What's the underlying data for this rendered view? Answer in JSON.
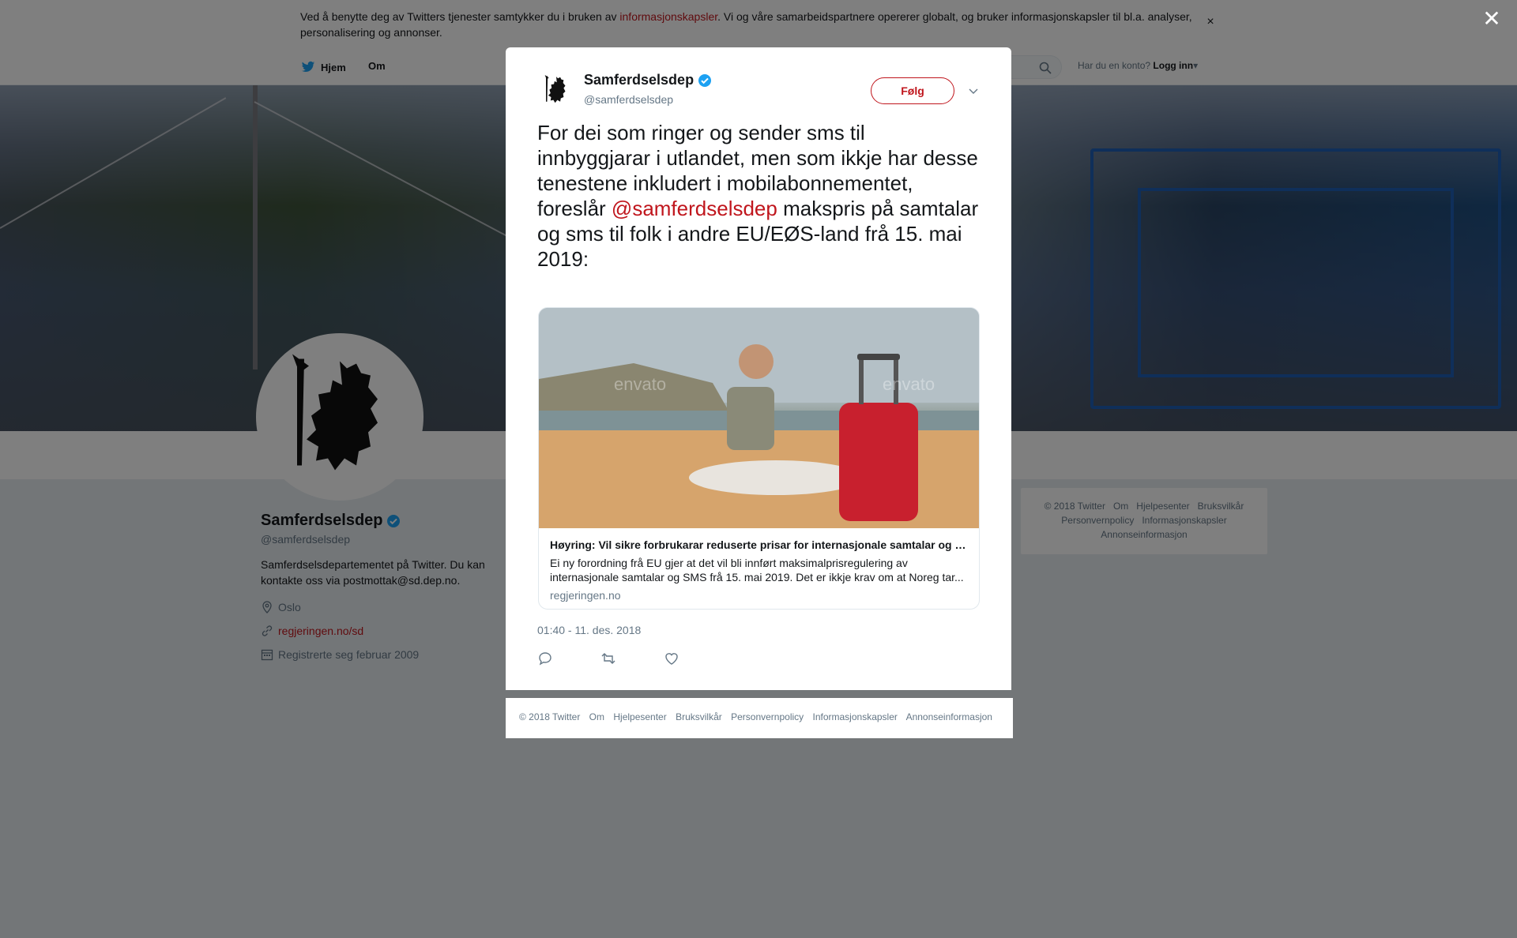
{
  "cookie": {
    "text_before": "Ved å benytte deg av Twitters tjenester samtykker du i bruken av ",
    "link": "informasjonskapsler",
    "text_after": ". Vi og våre samarbeidspartnere opererer globalt, og bruker informasjonskapsler til bl.a. analyser, personalisering og annonser.",
    "close": "×"
  },
  "nav": {
    "home": "Hjem",
    "about": "Om",
    "have_account": "Har du en konto?",
    "login": "Logg inn"
  },
  "profile": {
    "name": "Samferdselsdep",
    "handle": "@samferdselsdep",
    "bio": "Samferdselsdepartementet på Twitter. Du kan kontakte oss via postmottak@sd.dep.no.",
    "location": "Oslo",
    "url": "regjeringen.no/sd",
    "joined": "Registrerte seg februar 2009"
  },
  "side_footer": {
    "items": [
      "© 2018 Twitter",
      "Om",
      "Hjelpesenter",
      "Bruksvilkår",
      "Personvernpolicy",
      "Informasjonskapsler",
      "Annonseinformasjon"
    ]
  },
  "overlay": {
    "close": "✕"
  },
  "tweet": {
    "name": "Samferdselsdep",
    "handle": "@samferdselsdep",
    "follow": "Følg",
    "text_before": "For dei som ringer og sender sms til innbyggjarar i utlandet, men som ikkje har desse tenestene inkludert i mobilabonnementet, foreslår ",
    "mention": "@samferdselsdep",
    "text_after": " makspris på samtalar og sms til folk i andre EU/EØS-land frå 15. mai 2019:",
    "card": {
      "title": "Høyring: Vil sikre forbrukarar reduserte prisar for internasjonale samtalar og SMS",
      "description": "Ei ny forordning frå EU gjer at det vil bli innført maksimalprisregulering av internasjonale samtalar og SMS frå 15. mai 2019. Det er ikkje krav om at Noreg tar...",
      "domain": "regjeringen.no",
      "watermark_1": "envato",
      "watermark_2": "envato"
    },
    "timestamp": "01:40 - 11. des. 2018"
  },
  "modal_footer": {
    "items": [
      "© 2018 Twitter",
      "Om",
      "Hjelpesenter",
      "Bruksvilkår",
      "Personvernpolicy",
      "Informasjonskapsler",
      "Annonseinformasjon"
    ]
  },
  "colors": {
    "accent": "#c0161d",
    "verified": "#1da1f2",
    "muted": "#657786"
  }
}
